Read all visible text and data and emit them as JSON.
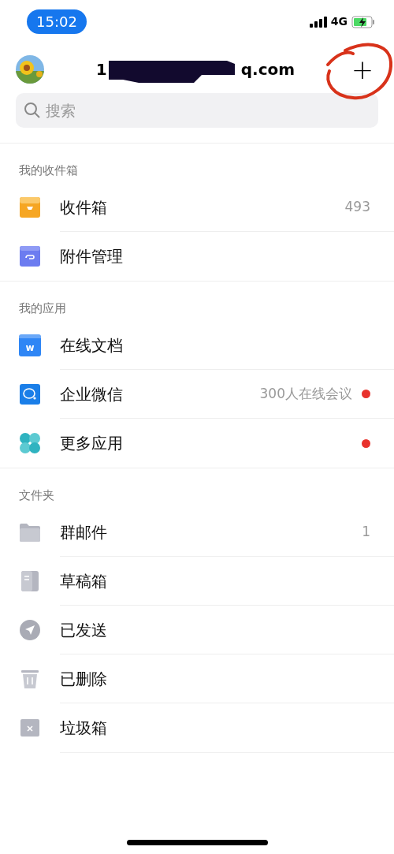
{
  "status_bar": {
    "time": "15:02",
    "network": "4G"
  },
  "header": {
    "account_start": "1",
    "account_end": "q.com",
    "add": "+"
  },
  "search": {
    "placeholder": "搜索"
  },
  "sections": [
    {
      "title": "我的收件箱",
      "items": [
        {
          "kind": "inbox",
          "label": "收件箱",
          "count": "493",
          "unread_dot": false
        },
        {
          "kind": "attachment",
          "label": "附件管理",
          "unread_dot": false
        }
      ]
    },
    {
      "title": "我的应用",
      "items": [
        {
          "kind": "doc",
          "icon_text": "w",
          "label": "在线文档",
          "unread_dot": false
        },
        {
          "kind": "chat",
          "label": "企业微信",
          "count": "300人在线会议",
          "unread_dot": true
        },
        {
          "kind": "apps",
          "label": "更多应用",
          "unread_dot": true
        }
      ]
    },
    {
      "title": "文件夹",
      "items": [
        {
          "kind": "folder",
          "label": "群邮件",
          "count": "1",
          "unread_dot": false
        },
        {
          "kind": "draft",
          "label": "草稿箱",
          "unread_dot": false
        },
        {
          "kind": "sent",
          "label": "已发送",
          "unread_dot": false
        },
        {
          "kind": "trash",
          "label": "已删除",
          "unread_dot": false
        },
        {
          "kind": "spam",
          "label": "垃圾箱",
          "unread_dot": false
        }
      ]
    }
  ]
}
